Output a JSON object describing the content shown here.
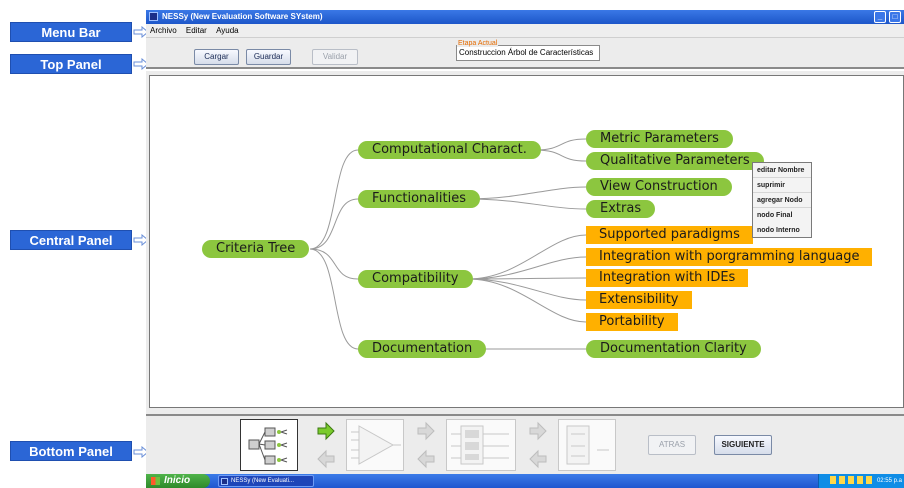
{
  "callouts": {
    "menu_bar": "Menu Bar",
    "top_panel": "Top Panel",
    "central_panel": "Central Panel",
    "bottom_panel": "Bottom Panel"
  },
  "window": {
    "title": "NESSy (New Evaluation Software SYstem)"
  },
  "menu": [
    "Archivo",
    "Editar",
    "Ayuda"
  ],
  "top_panel": {
    "cargar": "Cargar",
    "guardar": "Guardar",
    "validar": "Validar",
    "etapa_label": "Etapa Actual",
    "etapa_value": "Construccion Árbol de Características"
  },
  "tree": {
    "root": "Criteria Tree",
    "level1": [
      "Computational Charact.",
      "Functionalities",
      "Compatibility",
      "Documentation"
    ],
    "leaves": {
      "computational": [
        "Metric Parameters",
        "Qualitative Parameters"
      ],
      "functionalities": [
        "View Construction",
        "Extras"
      ],
      "compatibility": [
        "Supported paradigms",
        "Integration with porgramming language",
        "Integration with IDEs",
        "Extensibility",
        "Portability"
      ],
      "documentation": [
        "Documentation Clarity"
      ]
    },
    "colors": {
      "green": "#8cc63f",
      "orange": "#ffb000"
    }
  },
  "context_menu": [
    "editar Nombre",
    "suprimir",
    "agregar Nodo",
    "nodo Final",
    "nodo Interno"
  ],
  "bottom_panel": {
    "atras": "ATRAS",
    "siguiente": "SIGUIENTE"
  },
  "taskbar": {
    "start": "Inicio",
    "task": "NESSy (New Evaluati...",
    "clock": "02:55 p.a"
  }
}
